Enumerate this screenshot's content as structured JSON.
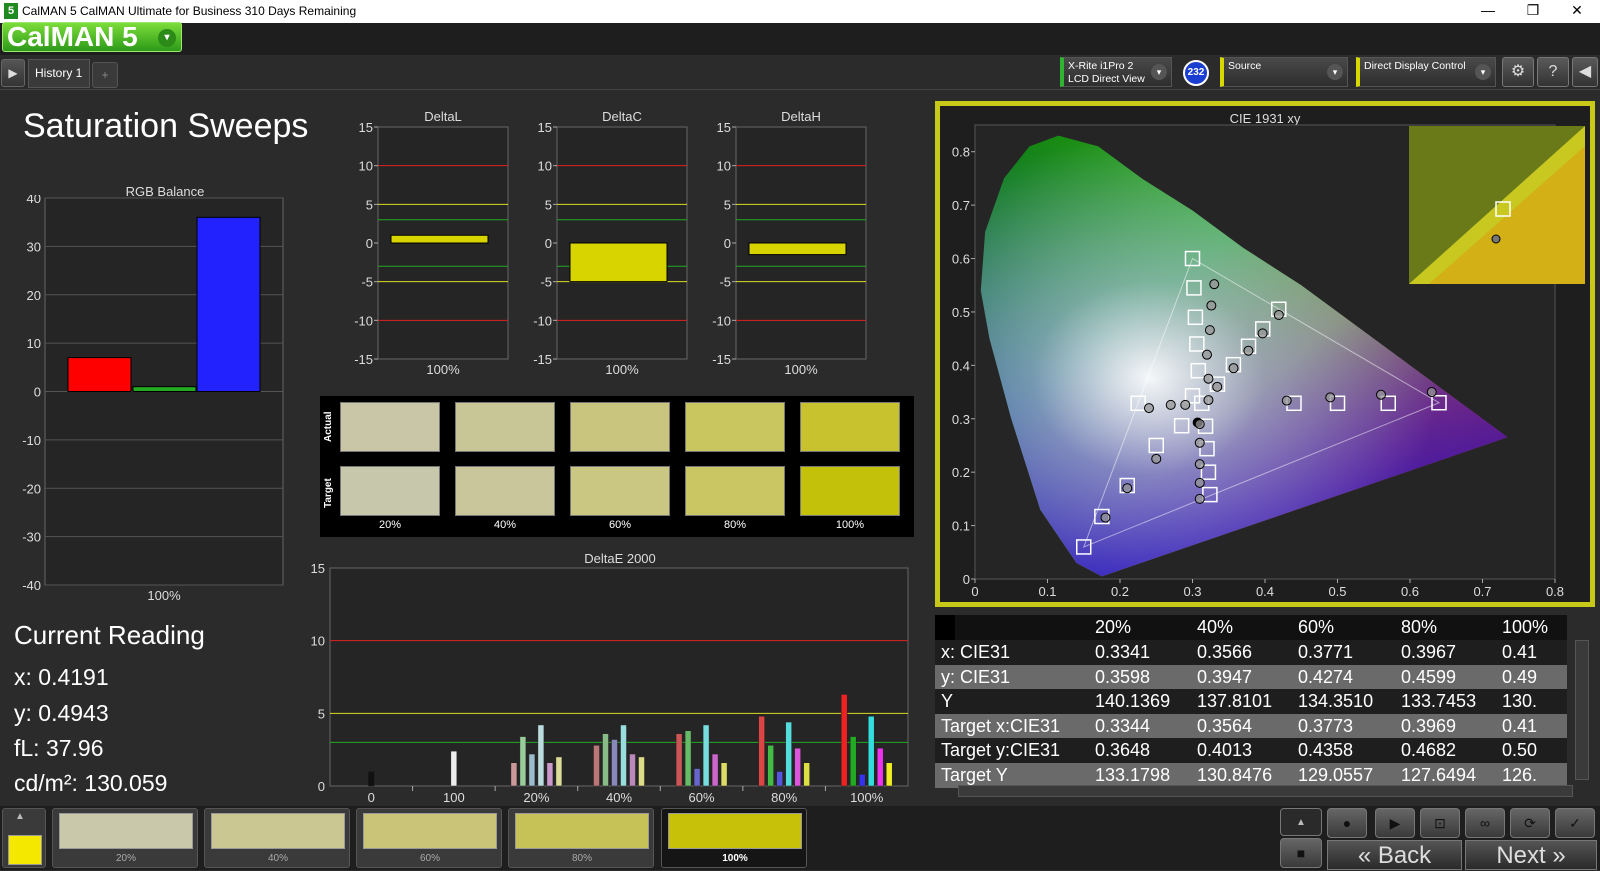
{
  "window": {
    "icon_label": "5",
    "title": "CalMAN 5 CalMAN Ultimate for Business 310 Days Remaining",
    "min": "—",
    "max": "❐",
    "close": "✕"
  },
  "logo": {
    "text": "CalMAN 5",
    "arrow": "▾"
  },
  "tabs": {
    "history": "History 1",
    "add": "+",
    "left_arrow": "▶"
  },
  "devices": {
    "meter_line1": "X-Rite i1Pro 2",
    "meter_line2": "LCD Direct View",
    "badge": "232",
    "source": "Source",
    "display": "Direct Display Control"
  },
  "toolbar_icons": [
    "gear-icon",
    "help-icon",
    "collapse-icon"
  ],
  "page_title": "Saturation Sweeps",
  "rgb_balance": {
    "title": "RGB Balance",
    "yticks": [
      "40",
      "30",
      "20",
      "10",
      "0",
      "-10",
      "-20",
      "-30",
      "-40"
    ],
    "xlabel": "100%",
    "values": {
      "red": 7,
      "green": 1,
      "blue": 36
    },
    "ylim": [
      -40,
      40
    ]
  },
  "delta_charts": [
    {
      "title": "DeltaL",
      "value": 1,
      "xlabel": "100%"
    },
    {
      "title": "DeltaC",
      "value": -5,
      "xlabel": "100%"
    },
    {
      "title": "DeltaH",
      "value": -1.5,
      "xlabel": "100%"
    }
  ],
  "delta_yticks": [
    "15",
    "10",
    "5",
    "0",
    "-5",
    "-10",
    "-15"
  ],
  "swatches": {
    "actual_label": "Actual",
    "target_label": "Target",
    "labels": [
      "20%",
      "40%",
      "60%",
      "80%",
      "100%"
    ],
    "actual": [
      "#c9c6a8",
      "#c8c597",
      "#c9c57f",
      "#cac65f",
      "#c7c22e"
    ],
    "target": [
      "#c7c7ab",
      "#c8c69a",
      "#cac782",
      "#cac664",
      "#c4c10a"
    ]
  },
  "deltae": {
    "title": "DeltaE 2000",
    "yticks": [
      "15",
      "10",
      "5",
      "0"
    ],
    "xticks": [
      "0",
      "100",
      "20%",
      "40%",
      "60%",
      "80%",
      "100%"
    ],
    "ylim": [
      0,
      15
    ],
    "groups": [
      {
        "cat": "0",
        "bars": [
          {
            "c": "#111",
            "v": 1.0
          }
        ]
      },
      {
        "cat": "100",
        "bars": [
          {
            "c": "#eee",
            "v": 2.4
          }
        ]
      },
      {
        "cat": "20%",
        "bars": [
          {
            "c": "#c99",
            "v": 1.6
          },
          {
            "c": "#9c9",
            "v": 3.4
          },
          {
            "c": "#9bc",
            "v": 2.2
          },
          {
            "c": "#bdd",
            "v": 4.2
          },
          {
            "c": "#c9c",
            "v": 1.6
          },
          {
            "c": "#dd9",
            "v": 2.0
          }
        ]
      },
      {
        "cat": "40%",
        "bars": [
          {
            "c": "#b77",
            "v": 2.8
          },
          {
            "c": "#8b8",
            "v": 3.6
          },
          {
            "c": "#88b",
            "v": 3.2
          },
          {
            "c": "#9dd",
            "v": 4.2
          },
          {
            "c": "#b8b",
            "v": 2.2
          },
          {
            "c": "#dd8",
            "v": 2.0
          }
        ]
      },
      {
        "cat": "60%",
        "bars": [
          {
            "c": "#c55",
            "v": 3.6
          },
          {
            "c": "#6b6",
            "v": 3.8
          },
          {
            "c": "#66c",
            "v": 1.2
          },
          {
            "c": "#7dd",
            "v": 4.2
          },
          {
            "c": "#c6c",
            "v": 2.2
          },
          {
            "c": "#dd6",
            "v": 1.6
          }
        ]
      },
      {
        "cat": "80%",
        "bars": [
          {
            "c": "#d44",
            "v": 4.8
          },
          {
            "c": "#4b4",
            "v": 2.8
          },
          {
            "c": "#55d",
            "v": 1.0
          },
          {
            "c": "#5dd",
            "v": 4.4
          },
          {
            "c": "#d5d",
            "v": 2.6
          },
          {
            "c": "#dd4",
            "v": 1.6
          }
        ]
      },
      {
        "cat": "100%",
        "bars": [
          {
            "c": "#e22",
            "v": 6.3
          },
          {
            "c": "#2a2",
            "v": 3.4
          },
          {
            "c": "#33e",
            "v": 0.8
          },
          {
            "c": "#3dd",
            "v": 4.8
          },
          {
            "c": "#e3e",
            "v": 2.6
          },
          {
            "c": "#ee2",
            "v": 1.6
          }
        ]
      }
    ]
  },
  "current_reading": {
    "heading": "Current Reading",
    "x": "x: 0.4191",
    "y": "y: 0.4943",
    "fl": "fL: 37.96",
    "cdm2": "cd/m²: 130.059"
  },
  "cie": {
    "title": "CIE 1931 xy",
    "xticks": [
      "0",
      "0.1",
      "0.2",
      "0.3",
      "0.4",
      "0.5",
      "0.6",
      "0.7",
      "0.8"
    ],
    "yticks": [
      "0.8",
      "0.7",
      "0.6",
      "0.5",
      "0.4",
      "0.3",
      "0.2",
      "0.1",
      "0"
    ],
    "xlim": [
      0,
      0.8
    ],
    "ylim": [
      0,
      0.85
    ],
    "gamut": [
      [
        0.64,
        0.33
      ],
      [
        0.3,
        0.6
      ],
      [
        0.15,
        0.06
      ]
    ],
    "targets": [
      [
        0.3127,
        0.329
      ],
      [
        0.3344,
        0.3648
      ],
      [
        0.3564,
        0.4013
      ],
      [
        0.3773,
        0.4358
      ],
      [
        0.3969,
        0.4682
      ],
      [
        0.419,
        0.505
      ],
      [
        0.3,
        0.6
      ],
      [
        0.302,
        0.545
      ],
      [
        0.304,
        0.49
      ],
      [
        0.306,
        0.44
      ],
      [
        0.308,
        0.39
      ],
      [
        0.3,
        0.343
      ],
      [
        0.225,
        0.329
      ],
      [
        0.44,
        0.329
      ],
      [
        0.5,
        0.329
      ],
      [
        0.57,
        0.329
      ],
      [
        0.64,
        0.33
      ],
      [
        0.318,
        0.286
      ],
      [
        0.32,
        0.244
      ],
      [
        0.322,
        0.2
      ],
      [
        0.324,
        0.158
      ],
      [
        0.25,
        0.25
      ],
      [
        0.21,
        0.175
      ],
      [
        0.175,
        0.117
      ],
      [
        0.15,
        0.06
      ],
      [
        0.285,
        0.287
      ]
    ],
    "actual": [
      [
        0.3071,
        0.293
      ],
      [
        0.3341,
        0.3598
      ],
      [
        0.3566,
        0.3947
      ],
      [
        0.3771,
        0.4274
      ],
      [
        0.3967,
        0.4599
      ],
      [
        0.4191,
        0.4943
      ],
      [
        0.33,
        0.552
      ],
      [
        0.326,
        0.512
      ],
      [
        0.324,
        0.466
      ],
      [
        0.32,
        0.42
      ],
      [
        0.322,
        0.375
      ],
      [
        0.322,
        0.335
      ],
      [
        0.24,
        0.32
      ],
      [
        0.27,
        0.326
      ],
      [
        0.29,
        0.326
      ],
      [
        0.43,
        0.334
      ],
      [
        0.49,
        0.34
      ],
      [
        0.56,
        0.345
      ],
      [
        0.63,
        0.35
      ],
      [
        0.31,
        0.29
      ],
      [
        0.31,
        0.255
      ],
      [
        0.31,
        0.215
      ],
      [
        0.31,
        0.18
      ],
      [
        0.31,
        0.15
      ],
      [
        0.25,
        0.225
      ],
      [
        0.21,
        0.17
      ],
      [
        0.18,
        0.115
      ]
    ],
    "inset_target": [
      0.41,
      0.5
    ],
    "inset_actual": [
      0.419,
      0.494
    ]
  },
  "table": {
    "headers": [
      "",
      "20%",
      "40%",
      "60%",
      "80%",
      "100%"
    ],
    "rows": [
      [
        "x: CIE31",
        "0.3341",
        "0.3566",
        "0.3771",
        "0.3967",
        "0.41"
      ],
      [
        "y: CIE31",
        "0.3598",
        "0.3947",
        "0.4274",
        "0.4599",
        "0.49"
      ],
      [
        "Y",
        "140.1369",
        "137.8101",
        "134.3510",
        "133.7453",
        "130."
      ],
      [
        "Target x:CIE31",
        "0.3344",
        "0.3564",
        "0.3773",
        "0.3969",
        "0.41"
      ],
      [
        "Target y:CIE31",
        "0.3648",
        "0.4013",
        "0.4358",
        "0.4682",
        "0.50"
      ],
      [
        "Target Y",
        "133.1798",
        "130.8476",
        "129.0557",
        "127.6494",
        "126."
      ]
    ]
  },
  "bottom": {
    "current_color": "#f5e800",
    "swatches": [
      {
        "label": "20%",
        "color": "#c9c8aa"
      },
      {
        "label": "40%",
        "color": "#cac792"
      },
      {
        "label": "60%",
        "color": "#c9c478"
      },
      {
        "label": "80%",
        "color": "#c6c257"
      },
      {
        "label": "100%",
        "color": "#c8c10a"
      }
    ],
    "back": "Back",
    "next": "Next"
  }
}
